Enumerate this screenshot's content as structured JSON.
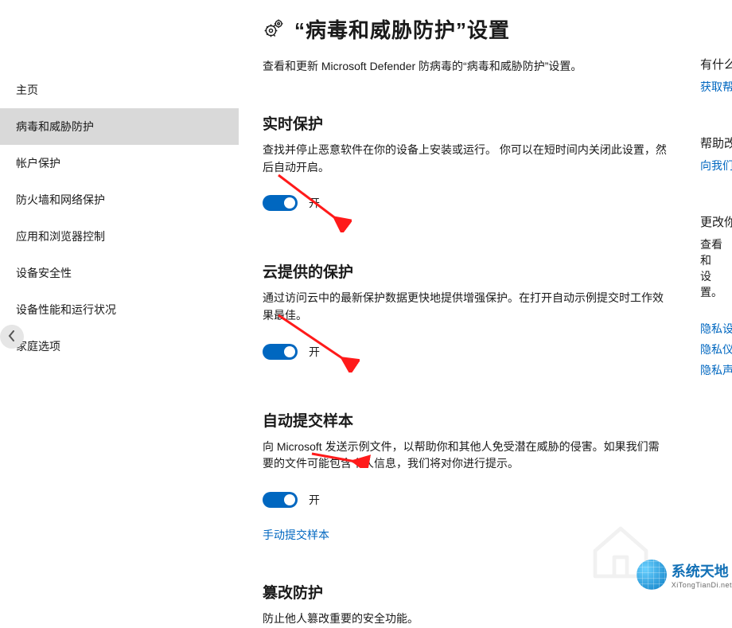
{
  "sidebar": {
    "items": [
      {
        "label": "主页"
      },
      {
        "label": "病毒和威胁防护",
        "selected": true
      },
      {
        "label": "帐户保护"
      },
      {
        "label": "防火墙和网络保护"
      },
      {
        "label": "应用和浏览器控制"
      },
      {
        "label": "设备安全性"
      },
      {
        "label": "设备性能和运行状况"
      },
      {
        "label": "家庭选项"
      }
    ]
  },
  "header": {
    "title": "“病毒和威胁防护”设置",
    "subtitle": "查看和更新 Microsoft Defender 防病毒的“病毒和威胁防护”设置。"
  },
  "sections": [
    {
      "key": "realtime",
      "title": "实时保护",
      "desc": "查找并停止恶意软件在你的设备上安装或运行。 你可以在短时间内关闭此设置，然后自动开启。",
      "toggle_on": true,
      "toggle_label": "开"
    },
    {
      "key": "cloud",
      "title": "云提供的保护",
      "desc": "通过访问云中的最新保护数据更快地提供增强保护。在打开自动示例提交时工作效果最佳。",
      "toggle_on": true,
      "toggle_label": "开"
    },
    {
      "key": "sample",
      "title": "自动提交样本",
      "desc": "向 Microsoft 发送示例文件，以帮助你和其他人免受潜在威胁的侵害。如果我们需要的文件可能包含个人信息，我们将对你进行提示。",
      "toggle_on": true,
      "toggle_label": "开",
      "link": "手动提交样本"
    },
    {
      "key": "tamper",
      "title": "篡改防护",
      "desc": "防止他人篡改重要的安全功能。"
    }
  ],
  "right": {
    "groups": [
      {
        "head": "有什么",
        "links": [
          "获取帮"
        ]
      },
      {
        "head": "帮助改",
        "links": [
          "向我们"
        ]
      },
      {
        "head": "更改你",
        "body": "查看和\n设置。",
        "links": [
          "隐私设",
          "隐私仪",
          "隐私声"
        ]
      }
    ]
  },
  "watermark": {
    "cn": "系统天地",
    "en": "XiTongTianDi.net"
  }
}
